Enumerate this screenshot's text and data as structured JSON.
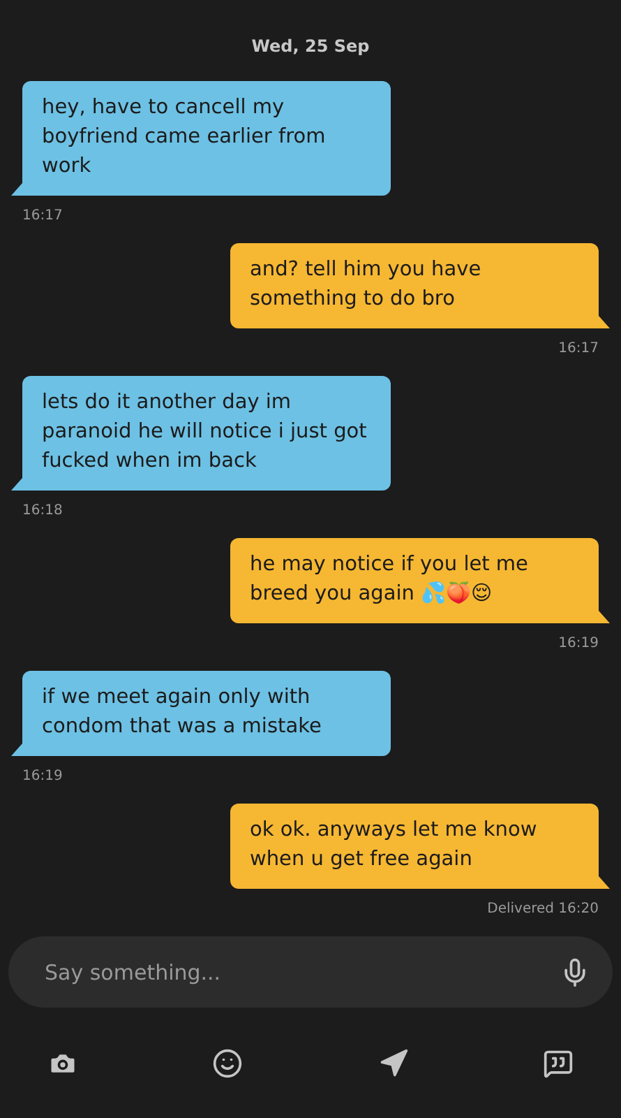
{
  "date_header": "Wed, 25 Sep",
  "messages": [
    {
      "kind": "received",
      "text": "hey, have to cancell my boyfriend came earlier from work",
      "time": "16:17"
    },
    {
      "kind": "sent",
      "text": "and? tell him you have something to do bro",
      "time": "16:17"
    },
    {
      "kind": "received",
      "text": "lets do it another day im paranoid he will notice i just got fucked when im back",
      "time": "16:18"
    },
    {
      "kind": "sent",
      "text": "he may notice if you let me breed you again 💦🍑😌",
      "time": "16:19"
    },
    {
      "kind": "received",
      "text": "if we meet again only with condom that was a mistake",
      "time": "16:19"
    },
    {
      "kind": "sent",
      "text": "ok ok. anyways let me know when u get free again",
      "time": "Delivered 16:20"
    }
  ],
  "composer": {
    "placeholder": "Say something..."
  }
}
